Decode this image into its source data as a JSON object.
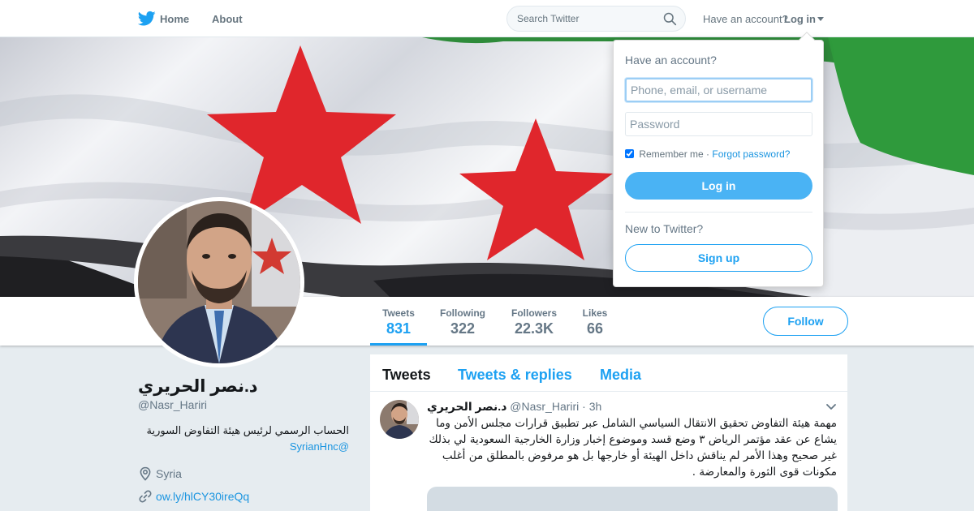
{
  "nav": {
    "home_label": "Home",
    "about_label": "About",
    "search_placeholder": "Search Twitter",
    "have_account_text": "Have an account?",
    "login_label": "Log in"
  },
  "profile_nav": {
    "stats": [
      {
        "label": "Tweets",
        "value": "831"
      },
      {
        "label": "Following",
        "value": "322"
      },
      {
        "label": "Followers",
        "value": "22.3K"
      },
      {
        "label": "Likes",
        "value": "66"
      }
    ],
    "follow_label": "Follow"
  },
  "profile": {
    "name": "د.نصر الحريري",
    "handle": "@Nasr_Hariri",
    "bio": "الحساب الرسمي لرئيس هيئة التفاوض السورية",
    "bio_mention": "@SyrianHnc",
    "location": "Syria",
    "website": "ow.ly/hlCY30ireQq"
  },
  "timeline": {
    "tabs": [
      "Tweets",
      "Tweets & replies",
      "Media"
    ],
    "tweet": {
      "name": "د.نصر الحريري",
      "handle": "@Nasr_Hariri",
      "separator": "·",
      "time": "3h",
      "text": "مهمة هيئة التفاوض تحقيق الانتقال السياسي الشامل عبر تطبيق قرارات مجلس الأمن وما يشاع عن عقد مؤتمر الرياض ٣ وضع قسد وموضوع إخبار وزارة الخارجية السعودية لي بذلك غير صحيح وهذا الأمر لم يناقش داخل الهيئة أو خارجها بل هو مرفوض بالمطلق من أغلب مكونات قوى الثورة والمعارضة ."
    }
  },
  "login_dropdown": {
    "title": "Have an account?",
    "username_placeholder": "Phone, email, or username",
    "password_placeholder": "Password",
    "remember_label": "Remember me",
    "remember_separator": "·",
    "forgot_label": "Forgot password?",
    "login_button": "Log in",
    "new_to_twitter": "New to Twitter?",
    "signup_button": "Sign up"
  },
  "colors": {
    "accent": "#1da1f2",
    "login_button_bg": "#4ab3f4",
    "flag_red": "#e0262c",
    "flag_green": "#2e8b3a",
    "flag_black": "#222222"
  },
  "icons": {
    "logo": "twitter-bird-icon",
    "search": "search-icon",
    "location": "location-pin-icon",
    "link": "link-icon",
    "caret": "chevron-down-icon"
  }
}
